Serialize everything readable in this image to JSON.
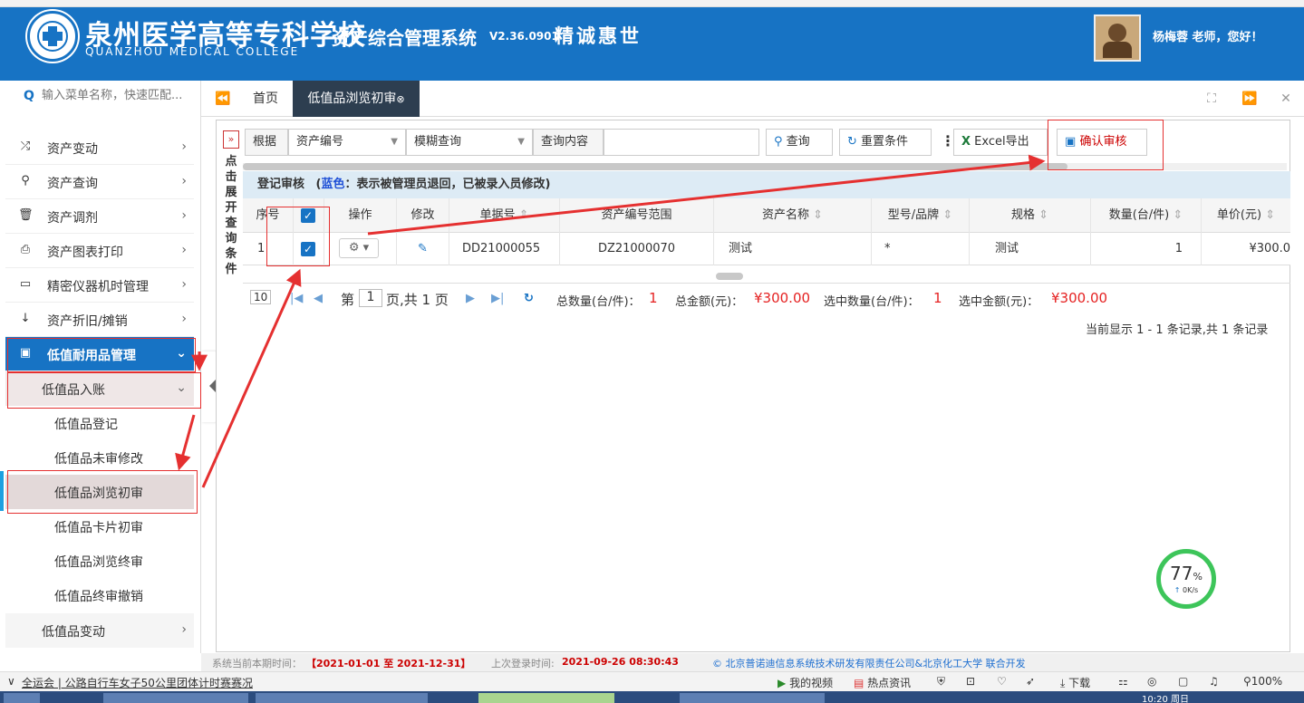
{
  "header": {
    "school_cn": "泉州医学高等专科学校",
    "school_en": "QUANZHOU MEDICAL COLLEGE",
    "system_title": "资产综合管理系统",
    "version": "V2.36.0901",
    "motto": "精诚惠世",
    "greeting": "杨梅蓉 老师，您好！",
    "bg_color": "#1773c4"
  },
  "sidebar": {
    "search_placeholder": "输入菜单名称，快速匹配...",
    "menu": [
      {
        "label": "资产变动",
        "icon": "shuffle-icon"
      },
      {
        "label": "资产查询",
        "icon": "search-icon"
      },
      {
        "label": "资产调剂",
        "icon": "trash-icon"
      },
      {
        "label": "资产图表打印",
        "icon": "printer-icon"
      },
      {
        "label": "精密仪器机时管理",
        "icon": "monitor-icon"
      },
      {
        "label": "资产折旧/摊销",
        "icon": "sort-icon"
      },
      {
        "label": "低值耐用品管理",
        "icon": "money-icon"
      }
    ],
    "sub_group": "低值品入账",
    "leaves": [
      "低值品登记",
      "低值品未审修改",
      "低值品浏览初审",
      "低值品卡片初审",
      "低值品浏览终审",
      "低值品终审撤销"
    ],
    "bottom_group": "低值品变动"
  },
  "tabs": {
    "home": "首页",
    "active": "低值品浏览初审"
  },
  "toolbar": {
    "cond_toggle": "»",
    "cond_text": "点击展开查询条件",
    "by_label": "根据",
    "field_select": "资产编号",
    "mode_select": "模糊查询",
    "content_label": "查询内容",
    "search_btn": "查询",
    "reset_btn": "重置条件",
    "excel_btn": "Excel导出",
    "confirm_btn": "确认审核"
  },
  "grid": {
    "caption": "登记审核",
    "caption_blue": "蓝色：表示被管理员退回，已被录入员修改)",
    "caption_open": "(",
    "columns": [
      "序号",
      "操作",
      "修改",
      "单据号",
      "资产编号范围",
      "资产名称",
      "型号/品牌",
      "规格",
      "数量(台/件)",
      "单价(元)"
    ],
    "rows": [
      {
        "seq": "1",
        "doc_no": "DD21000055",
        "asset_range": "DZ21000070",
        "name": "测试",
        "model": "*",
        "spec": "测试",
        "qty": "1",
        "price": "¥300.0"
      }
    ]
  },
  "pager": {
    "page_size": "10",
    "page_prefix": "第",
    "page_value": "1",
    "page_suffix": "页,共 1 页",
    "total_qty_label": "总数量(台/件)：",
    "total_qty": "1",
    "total_amount_label": "总金额(元)：",
    "total_amount": "¥300.00",
    "sel_qty_label": "选中数量(台/件)：",
    "sel_qty": "1",
    "sel_amount_label": "选中金额(元)：",
    "sel_amount": "¥300.00",
    "record_info": "当前显示 1 - 1 条记录,共 1 条记录"
  },
  "footer": {
    "period_label": "系统当前本期时间：",
    "period": "【2021-01-01 至 2021-12-31】",
    "last_login_label": "上次登录时间:",
    "last_login": "2021-09-26 08:30:43",
    "copyright": "© 北京普诺迪信息系统技术研发有限责任公司&北京化工大学 联合开发"
  },
  "statusbar": {
    "news": "全运会 | 公路自行车女子50公里团体计时赛赛况",
    "video": "我的视频",
    "hot": "热点资讯",
    "download": "下载",
    "zoom": "100%"
  },
  "net_widget": {
    "percent": "77",
    "unit": "%",
    "speed": "0K/s"
  },
  "taskbar": {
    "clock": "10:20 周日"
  }
}
